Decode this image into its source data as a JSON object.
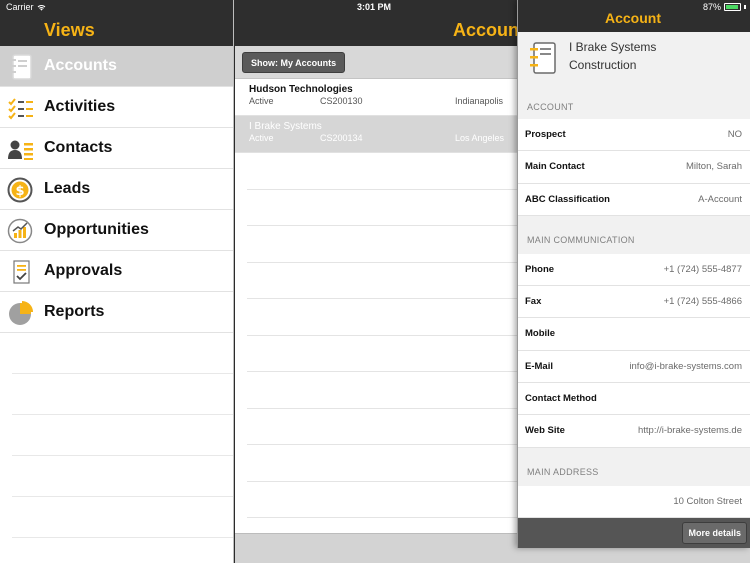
{
  "status": {
    "carrier": "Carrier",
    "time": "3:01 PM",
    "battery": "87%"
  },
  "views": {
    "title": "Views",
    "items": [
      {
        "label": "Accounts",
        "icon": "address-book-icon",
        "active": true
      },
      {
        "label": "Activities",
        "icon": "checklist-icon",
        "active": false
      },
      {
        "label": "Contacts",
        "icon": "person-icon",
        "active": false
      },
      {
        "label": "Leads",
        "icon": "dollar-coin-icon",
        "active": false
      },
      {
        "label": "Opportunities",
        "icon": "growth-chart-icon",
        "active": false
      },
      {
        "label": "Approvals",
        "icon": "approval-document-icon",
        "active": false
      },
      {
        "label": "Reports",
        "icon": "pie-chart-icon",
        "active": false
      }
    ]
  },
  "accounts": {
    "title": "Accounts",
    "filter_button": "Show: My Accounts",
    "rows": [
      {
        "name": "Hudson Technologies",
        "status": "Active",
        "id": "CS200130",
        "city": "Indianapolis",
        "selected": false
      },
      {
        "name": "I Brake Systems",
        "status": "Active",
        "id": "CS200134",
        "city": "Los Angeles",
        "selected": true
      }
    ]
  },
  "detail": {
    "title": "Account",
    "company_line1": "I Brake Systems",
    "company_line2": "Construction",
    "sections": {
      "account": {
        "label": "ACCOUNT",
        "fields": [
          {
            "label": "Prospect",
            "value": "NO"
          },
          {
            "label": "Main Contact",
            "value": "Milton, Sarah"
          },
          {
            "label": "ABC Classification",
            "value": "A-Account"
          }
        ]
      },
      "communication": {
        "label": "MAIN COMMUNICATION",
        "fields": [
          {
            "label": "Phone",
            "value": "+1 (724) 555-4877"
          },
          {
            "label": "Fax",
            "value": "+1 (724) 555-4866"
          },
          {
            "label": "Mobile",
            "value": ""
          },
          {
            "label": "E-Mail",
            "value": "info@i-brake-systems.com"
          },
          {
            "label": "Contact Method",
            "value": ""
          },
          {
            "label": "Web Site",
            "value": "http://i-brake-systems.de"
          }
        ]
      },
      "address": {
        "label": "MAIN ADDRESS",
        "fields": [
          {
            "label": "",
            "value": "10 Colton Street"
          }
        ]
      }
    },
    "more_button": "More details"
  },
  "colors": {
    "accent": "#f6b316",
    "header_bg": "#2e2e2e",
    "selected_bg": "#d6d6d6"
  }
}
